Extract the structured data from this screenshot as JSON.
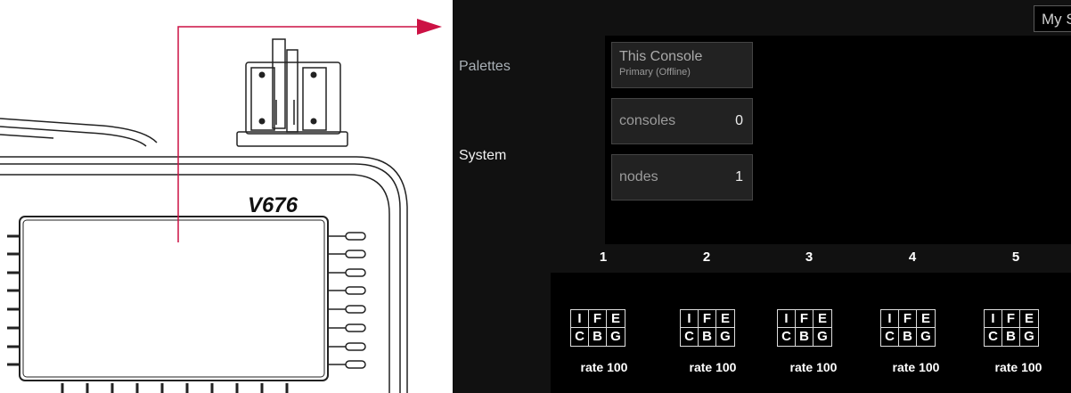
{
  "device": {
    "model": "V676"
  },
  "header": {
    "user_button": "My S"
  },
  "sidebar": {
    "palettes": "Palettes",
    "system": "System"
  },
  "console_tile": {
    "title": "This Console",
    "subtitle": "Primary (Offline)"
  },
  "consoles_tile": {
    "label": "consoles",
    "value": "0"
  },
  "nodes_tile": {
    "label": "nodes",
    "value": "1"
  },
  "columns": [
    {
      "number": "1",
      "keys": [
        "I",
        "F",
        "E",
        "C",
        "B",
        "G"
      ],
      "rate": "rate 100"
    },
    {
      "number": "2",
      "keys": [
        "I",
        "F",
        "E",
        "C",
        "B",
        "G"
      ],
      "rate": "rate 100"
    },
    {
      "number": "3",
      "keys": [
        "I",
        "F",
        "E",
        "C",
        "B",
        "G"
      ],
      "rate": "rate 100"
    },
    {
      "number": "4",
      "keys": [
        "I",
        "F",
        "E",
        "C",
        "B",
        "G"
      ],
      "rate": "rate 100"
    },
    {
      "number": "5",
      "keys": [
        "I",
        "F",
        "E",
        "C",
        "B",
        "G"
      ],
      "rate": "rate 100"
    }
  ],
  "colors": {
    "screen_bg": "#111111",
    "panel_bg": "#000000",
    "tile_bg": "#222222",
    "callout_arrow": "#cc1144"
  }
}
